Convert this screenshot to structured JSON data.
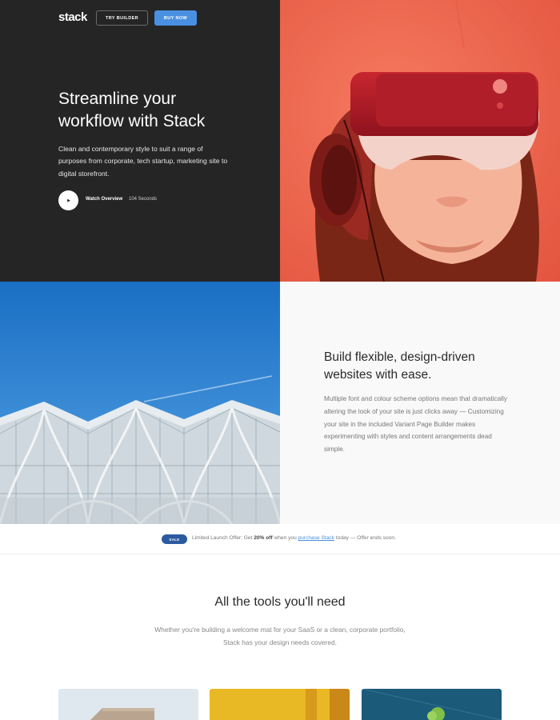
{
  "nav": {
    "logo": "stack",
    "try_builder": "TRY BUILDER",
    "buy_now": "BUY NOW"
  },
  "hero": {
    "title_line1": "Streamline your",
    "title_line2": "workflow with Stack",
    "text": "Clean and contemporary style to suit a range of purposes from corporate, tech startup, marketing site to digital storefront.",
    "play_icon": "▶",
    "watch_label": "Watch Overview",
    "watch_duration": "104 Seconds"
  },
  "feature": {
    "title_line1": "Build flexible, design-driven",
    "title_line2": "websites with ease.",
    "text": "Multiple font and colour scheme options mean that dramatically altering the look of your site is just clicks away — Customizing your site in the included Variant Page Builder makes experimenting with styles and content arrangements dead simple."
  },
  "offer": {
    "badge": "SALE",
    "prefix": "Limited Launch Offer: Get ",
    "discount": "20% off",
    "middle": " when you ",
    "link": "purchase Stack",
    "suffix": " today — Offer ends soon."
  },
  "tools": {
    "title": "All the tools you'll need",
    "text_line1": "Whether you're building a welcome mat for your SaaS or a clean, corporate portfolio,",
    "text_line2": "Stack has your design needs covered."
  },
  "colors": {
    "dark": "#252525",
    "accent_blue": "#4a90e2",
    "hero_image": "#f0634a",
    "sale_badge": "#2c5aa0"
  }
}
